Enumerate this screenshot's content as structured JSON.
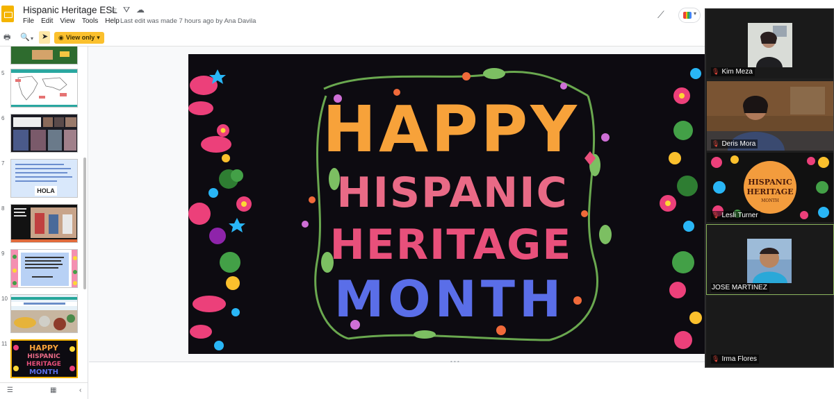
{
  "app": {
    "title": "Hispanic Heritage ESL",
    "last_edit": "Last edit was made 7 hours ago by Ana Davila",
    "menu": [
      "File",
      "Edit",
      "View",
      "Tools",
      "Help"
    ]
  },
  "toolbar": {
    "view_only_label": "View only",
    "view_only_caret": "▾"
  },
  "slides": [
    {
      "num": "",
      "kind": "green"
    },
    {
      "num": "5",
      "kind": "map"
    },
    {
      "num": "6",
      "kind": "photos"
    },
    {
      "num": "7",
      "kind": "hola",
      "hola_text": "HOLA"
    },
    {
      "num": "8",
      "kind": "dark"
    },
    {
      "num": "9",
      "kind": "quote"
    },
    {
      "num": "10",
      "kind": "food"
    },
    {
      "num": "11",
      "kind": "current"
    }
  ],
  "current_slide": {
    "lines": [
      "HAPPY",
      "HISPANIC",
      "HERITAGE",
      "MONTH"
    ]
  },
  "participants": [
    {
      "name": "Kim Meza",
      "muted": true
    },
    {
      "name": "Deris Mora",
      "muted": true
    },
    {
      "name": "Lesli Turner",
      "muted": true,
      "badge": [
        "HISPANIC",
        "HERITAGE",
        "MONTH"
      ]
    },
    {
      "name": "JOSE MARTINEZ",
      "muted": false
    },
    {
      "name": "Irma Flores",
      "muted": true
    }
  ],
  "colors": {
    "accent_yellow": "#fbc02d",
    "slide_bg": "#0d0b11",
    "happy": "#f7a23a",
    "hispanic": "#e96a86",
    "heritage": "#e8507b",
    "month": "#5a6ee8",
    "vine": "#6aa84f"
  },
  "icons": {
    "star": "star-icon",
    "drive": "move-to-drive-icon",
    "cloud": "cloud-saved-icon",
    "print": "print-icon",
    "zoom": "zoom-icon",
    "select": "select-cursor-icon",
    "eye": "eye-icon"
  }
}
